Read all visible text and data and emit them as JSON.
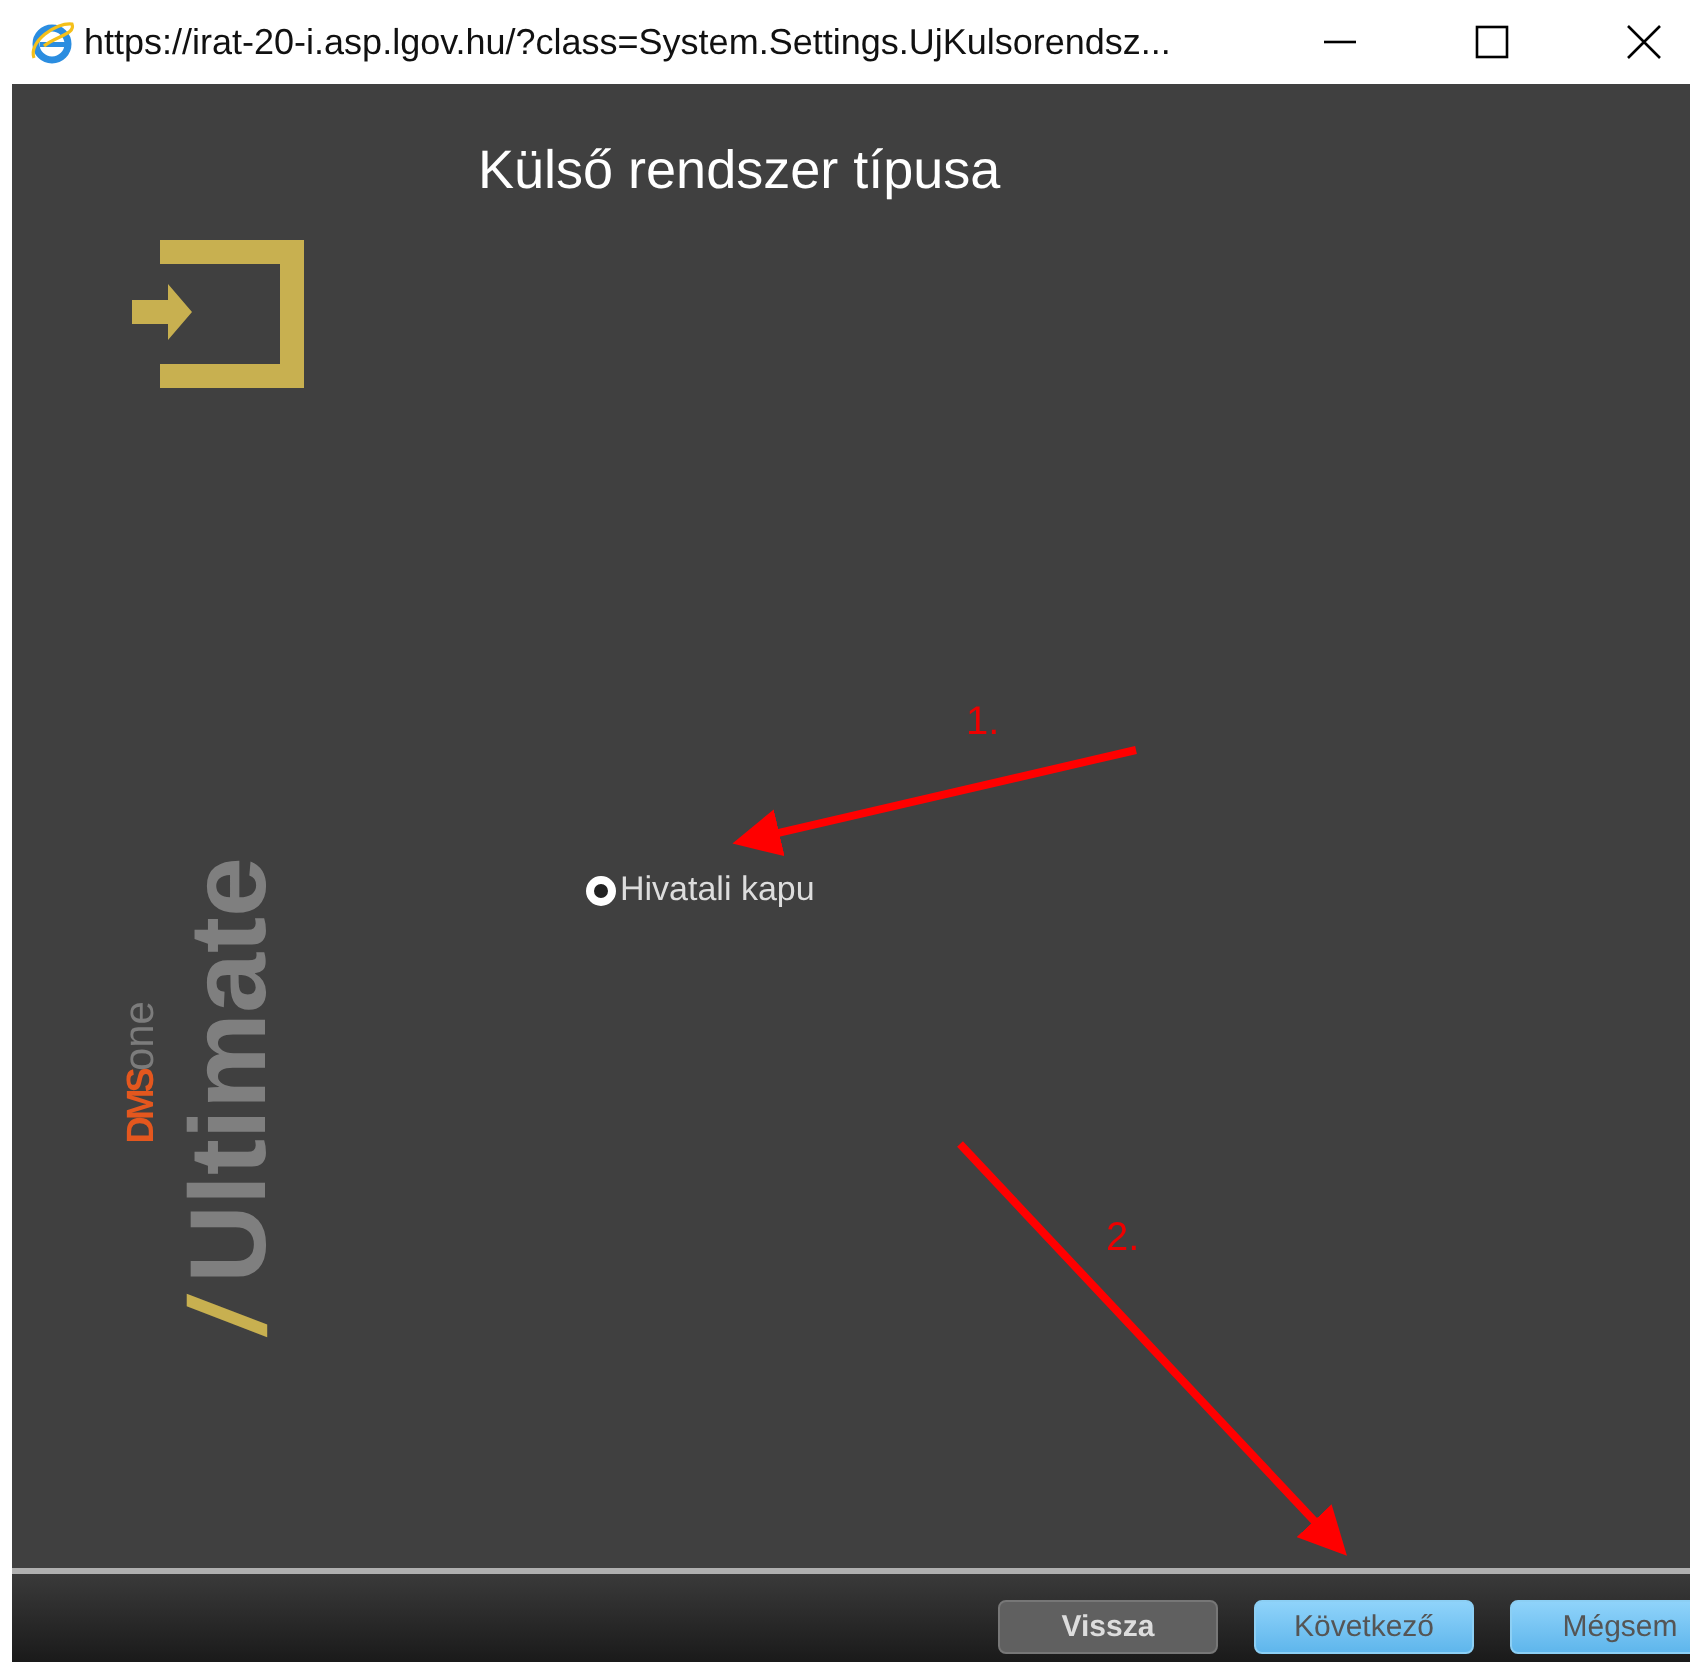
{
  "window": {
    "title": "https://irat-20-i.asp.lgov.hu/?class=System.Settings.UjKulsorendsz..."
  },
  "dialog": {
    "title": "Külső rendszer típusa",
    "logo": {
      "slash": "/",
      "word": "Ultimate",
      "brand": "DMS",
      "suffix": "one"
    },
    "options": [
      {
        "label": "Hivatali kapu",
        "selected": true
      }
    ],
    "annotations": [
      {
        "label": "1."
      },
      {
        "label": "2."
      }
    ],
    "buttons": [
      {
        "label": "Vissza",
        "disabled": true
      },
      {
        "label": "Következő",
        "disabled": false
      },
      {
        "label": "Mégsem",
        "disabled": false
      }
    ]
  }
}
